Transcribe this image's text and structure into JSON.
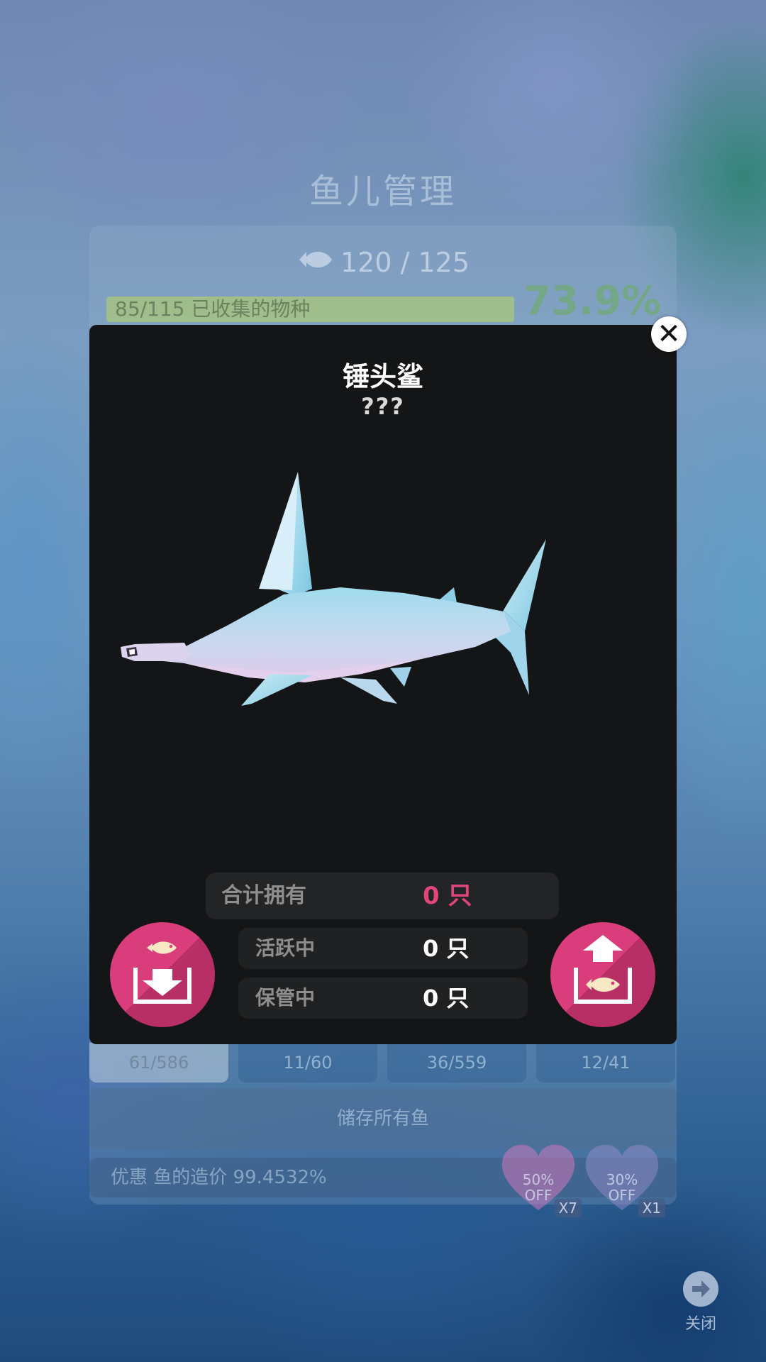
{
  "background": {
    "title": "鱼儿管理",
    "fish_count": "120 / 125",
    "collected_label": "85/115 已收集的物种",
    "collected_percent": "73.9%",
    "tabs": [
      "61/586",
      "11/60",
      "36/559",
      "12/41"
    ],
    "store_all_label": "储存所有鱼",
    "discount_label": "优惠 鱼的造价 99.4532%",
    "coupons": [
      {
        "text": "50%\nOFF",
        "multiplier": "X7"
      },
      {
        "text": "30%\nOFF",
        "multiplier": "X1"
      }
    ],
    "close_label": "关闭"
  },
  "modal": {
    "fish_name": "锤头鲨",
    "fish_subtitle": "???",
    "total_label": "合计拥有",
    "total_value": "0 只",
    "active_label": "活跃中",
    "active_value": "0 只",
    "stored_label": "保管中",
    "stored_value": "0 只",
    "close_symbol": "✕"
  },
  "colors": {
    "accent_pink": "#da3d7c",
    "modal_bg": "#141516",
    "total_value_color": "#e0467c"
  },
  "icons": {
    "store_button": "fish-into-box-icon",
    "release_button": "fish-out-of-box-icon"
  }
}
